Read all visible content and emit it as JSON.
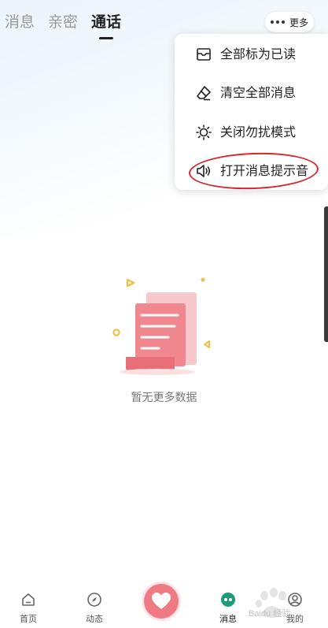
{
  "tabs": [
    {
      "label": "消息"
    },
    {
      "label": "亲密"
    },
    {
      "label": "通话"
    }
  ],
  "more": {
    "label": "更多"
  },
  "menu": {
    "items": [
      {
        "label": "全部标为已读",
        "icon": "envelope-icon"
      },
      {
        "label": "清空全部消息",
        "icon": "eraser-icon"
      },
      {
        "label": "关闭勿扰模式",
        "icon": "sun-icon"
      },
      {
        "label": "打开消息提示音",
        "icon": "speaker-icon"
      }
    ]
  },
  "empty": {
    "text": "暂无更多数据"
  },
  "bottom_nav": [
    {
      "label": "首页",
      "icon": "home-icon"
    },
    {
      "label": "动态",
      "icon": "compass-icon"
    },
    {
      "label": "",
      "icon": "heart-icon"
    },
    {
      "label": "消息",
      "icon": "message-icon"
    },
    {
      "label": "我的",
      "icon": "profile-icon"
    }
  ],
  "watermark": {
    "text": "Baidu 经验"
  },
  "colors": {
    "accent": "#f07a84",
    "highlight": "#d8262e",
    "active_text": "#222222",
    "inactive_text": "#9a9a9a"
  }
}
